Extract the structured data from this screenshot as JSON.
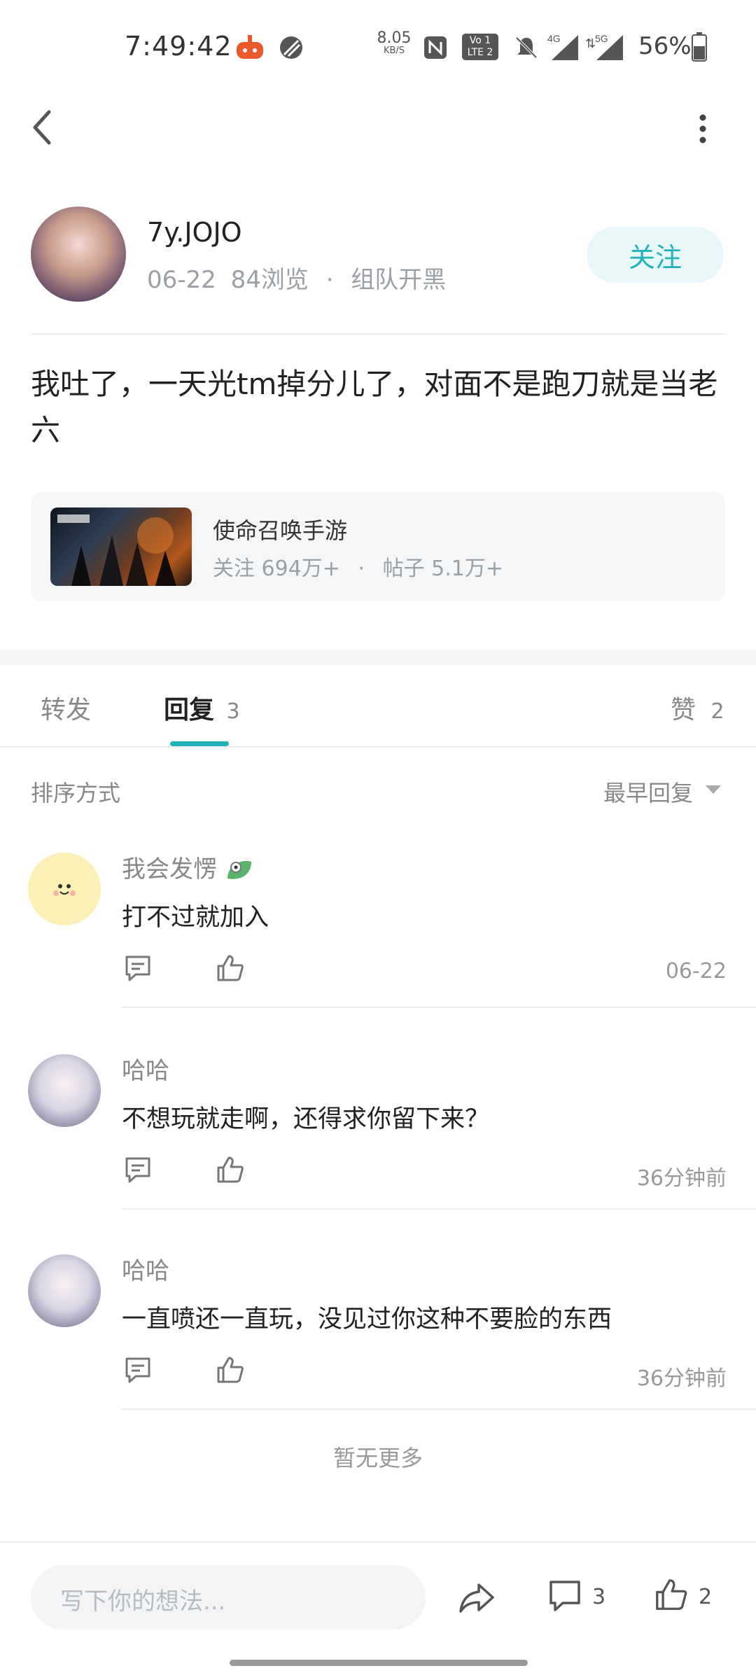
{
  "status_bar": {
    "time": "7:49:42",
    "net_speed_value": "8.05",
    "net_speed_unit": "KB/S",
    "volte": "Vo 1 LTE 2",
    "sig1": "4G",
    "sig2": "5G",
    "battery": "56%"
  },
  "post": {
    "author": "7y.JOJO",
    "date": "06-22",
    "views": "84浏览",
    "dot": "·",
    "category": "组队开黑",
    "follow_label": "关注",
    "content": "我吐了，一天光tm掉分儿了，对面不是跑刀就是当老六"
  },
  "game": {
    "name": "使命召唤手游",
    "followers": "关注 694万+",
    "dot": "·",
    "posts": "帖子 5.1万+"
  },
  "tabs": {
    "forward": "转发",
    "reply": "回复",
    "reply_count": "3",
    "like": "赞",
    "like_count": "2"
  },
  "sort": {
    "label": "排序方式",
    "value": "最早回复"
  },
  "comments": [
    {
      "name": "我会发愣",
      "text": "打不过就加入",
      "time": "06-22"
    },
    {
      "name": "哈哈",
      "text": "不想玩就走啊，还得求你留下来？",
      "time": "36分钟前"
    },
    {
      "name": "哈哈",
      "text": "一直喷还一直玩，没见过你这种不要脸的东西",
      "time": "36分钟前"
    }
  ],
  "no_more": "暂无更多",
  "bottom": {
    "placeholder": "写下你的想法...",
    "comment_count": "3",
    "like_count": "2"
  },
  "colors": {
    "accent": "#21b2ba",
    "follow_bg": "#e8f7f8",
    "muted_text": "#9aa0a6"
  },
  "icons": [
    "back-arrow-icon",
    "more-vertical-icon",
    "reply-icon",
    "thumb-up-icon",
    "share-icon",
    "comment-icon",
    "sort-triangle-icon",
    "leaf-badge-icon"
  ]
}
